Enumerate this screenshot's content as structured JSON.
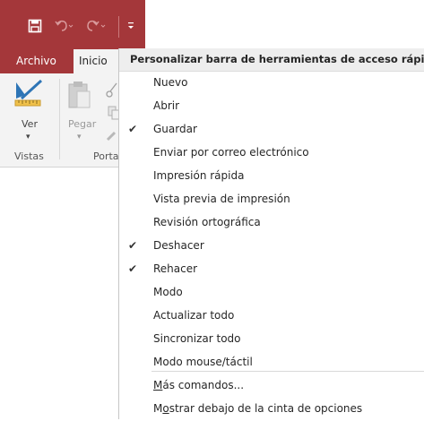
{
  "ribbon": {
    "tabs": [
      {
        "label": "Archivo"
      },
      {
        "label": "Inicio"
      }
    ],
    "ver_label": "Ver",
    "pegar_label": "Pegar",
    "group_vistas": "Vistas",
    "group_porta": "Porta"
  },
  "menu": {
    "header": "Personalizar barra de herramientas de acceso rápido",
    "items": [
      {
        "label": "Nuevo",
        "checked": false
      },
      {
        "label": "Abrir",
        "checked": false
      },
      {
        "label": "Guardar",
        "checked": true
      },
      {
        "label": "Enviar por correo electrónico",
        "checked": false
      },
      {
        "label": "Impresión rápida",
        "checked": false
      },
      {
        "label": "Vista previa de impresión",
        "checked": false
      },
      {
        "label": "Revisión ortográfica",
        "checked": false
      },
      {
        "label": "Deshacer",
        "checked": true
      },
      {
        "label": "Rehacer",
        "checked": true
      },
      {
        "label": "Modo",
        "checked": false
      },
      {
        "label": "Actualizar todo",
        "checked": false
      },
      {
        "label": "Sincronizar todo",
        "checked": false
      },
      {
        "label": "Modo mouse/táctil",
        "checked": false
      }
    ],
    "more_commands": {
      "access_key": "M",
      "rest": "ás comandos..."
    },
    "show_below": {
      "pre": "M",
      "access_key": "o",
      "rest": "strar debajo de la cinta de opciones"
    }
  },
  "colors": {
    "access_red": "#a4373a",
    "ribbon_bg": "#f3f3f3"
  },
  "icons": [
    "save-icon",
    "undo-icon",
    "redo-icon",
    "customize-qat-icon",
    "view-design-icon",
    "paste-icon",
    "cut-icon",
    "copy-icon",
    "check-icon"
  ]
}
